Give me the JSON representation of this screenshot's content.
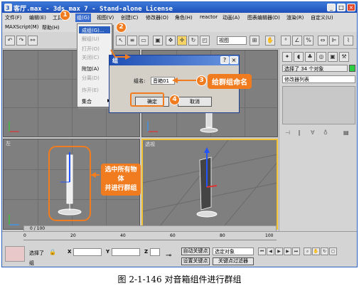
{
  "window": {
    "title": "客厅.max - 3ds max 7 - Stand-alone License"
  },
  "menubar": {
    "items": [
      "文件(F)",
      "编辑(E)",
      "工具",
      "组(G)",
      "视图(V)",
      "创建(C)",
      "修改器(O)",
      "角色(H)",
      "reactor",
      "动画(A)",
      "图表编辑器(D)",
      "渲染(R)",
      "自定义(U)"
    ],
    "row2": [
      "MAXScript(M)",
      "帮助(H)"
    ]
  },
  "toolbar": {
    "viewport_select": "视图"
  },
  "context_menu": {
    "items": [
      {
        "label": "成组(G)...",
        "state": "highlight"
      },
      {
        "label": "解组(U)",
        "state": "disabled"
      },
      {
        "label": "打开(O)",
        "state": "disabled"
      },
      {
        "label": "关闭(C)",
        "state": "disabled"
      },
      {
        "label": "附加(A)",
        "state": "normal"
      },
      {
        "label": "分离(D)",
        "state": "disabled"
      },
      {
        "label": "炸开(E)",
        "state": "disabled"
      },
      {
        "label": "集合",
        "state": "normal"
      }
    ]
  },
  "dialog": {
    "title": "组",
    "name_label": "组名:",
    "name_value": "音箱01",
    "ok_label": "确定",
    "cancel_label": "取消"
  },
  "command_panel": {
    "selection_info": "选择了 34 个对象",
    "modifier_list": "修改器列表"
  },
  "viewports": {
    "left_label": "左",
    "persp_label": "透视"
  },
  "annotations": {
    "step1": "1",
    "step2": "2",
    "step3": "3",
    "step4": "4",
    "callout3": "给群组命名",
    "callout_select": "选中所有物体\n并进行群组"
  },
  "timeline": {
    "frame": "0 / 100",
    "ticks": [
      "0",
      "20",
      "40",
      "60",
      "80",
      "100"
    ]
  },
  "status": {
    "selected": "选择了",
    "x_label": "X",
    "y_label": "Y",
    "z_label": "Z",
    "group_text": "组",
    "auto_key": "自动关键点",
    "set_key": "设置关键点",
    "select_object": "选定对象",
    "key_filter": "关键点过滤器"
  },
  "caption": "图 2-1-146    对音箱组件进行群组"
}
